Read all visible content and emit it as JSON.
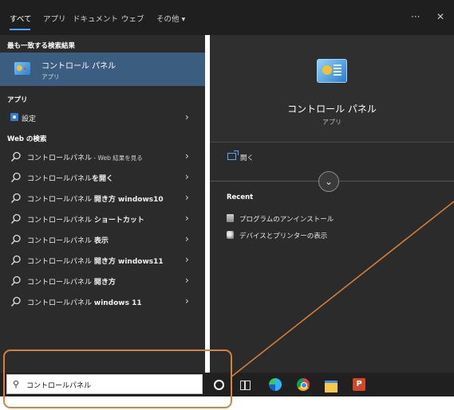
{
  "topbar": {
    "tabs": [
      {
        "label": "すべて",
        "active": true
      },
      {
        "label": "アプリ"
      },
      {
        "label": "ドキュメント"
      },
      {
        "label": "ウェブ"
      },
      {
        "label": "その他 ▾"
      }
    ],
    "more_glyph": "···",
    "close_glyph": "✕"
  },
  "left": {
    "best_match_header": "最も一致する検索結果",
    "best_match": {
      "title": "コントロール パネル",
      "subtitle": "アプリ",
      "icon": "control-panel-icon"
    },
    "apps_header": "アプリ",
    "apps": [
      {
        "label": "設定",
        "icon": "settings-icon"
      }
    ],
    "web_header": "Web の検索",
    "web_results": [
      {
        "prefix": "コントロールパネル",
        "bold": "",
        "suffix": " - Web 結果を見る"
      },
      {
        "prefix": "コントロールパネル",
        "bold": "を開く",
        "suffix": ""
      },
      {
        "prefix": "コントロールパネル ",
        "bold": "開き方 windows10",
        "suffix": ""
      },
      {
        "prefix": "コントロールパネル ",
        "bold": "ショートカット",
        "suffix": ""
      },
      {
        "prefix": "コントロールパネル ",
        "bold": "表示",
        "suffix": ""
      },
      {
        "prefix": "コントロールパネル ",
        "bold": "開き方 windows11",
        "suffix": ""
      },
      {
        "prefix": "コントロールパネル ",
        "bold": "開き方",
        "suffix": ""
      },
      {
        "prefix": "コントロールパネル ",
        "bold": "windows 11",
        "suffix": ""
      }
    ],
    "chevron": "›"
  },
  "right": {
    "app_name": "コントロール パネル",
    "app_type": "アプリ",
    "open_label": "開く",
    "expand_glyph": "⌄",
    "recent_header": "Recent",
    "recent_items": [
      {
        "label": "プログラムのアンインストール",
        "icon": "uninstall-icon"
      },
      {
        "label": "デバイスとプリンターの表示",
        "icon": "devices-printers-icon"
      }
    ]
  },
  "taskbar": {
    "search_value": "コントロールパネル",
    "search_icon": "⚲"
  },
  "colors": {
    "annotation": "#d9813a",
    "selected": "#3b5e80",
    "panel": "#2b2b2b"
  }
}
